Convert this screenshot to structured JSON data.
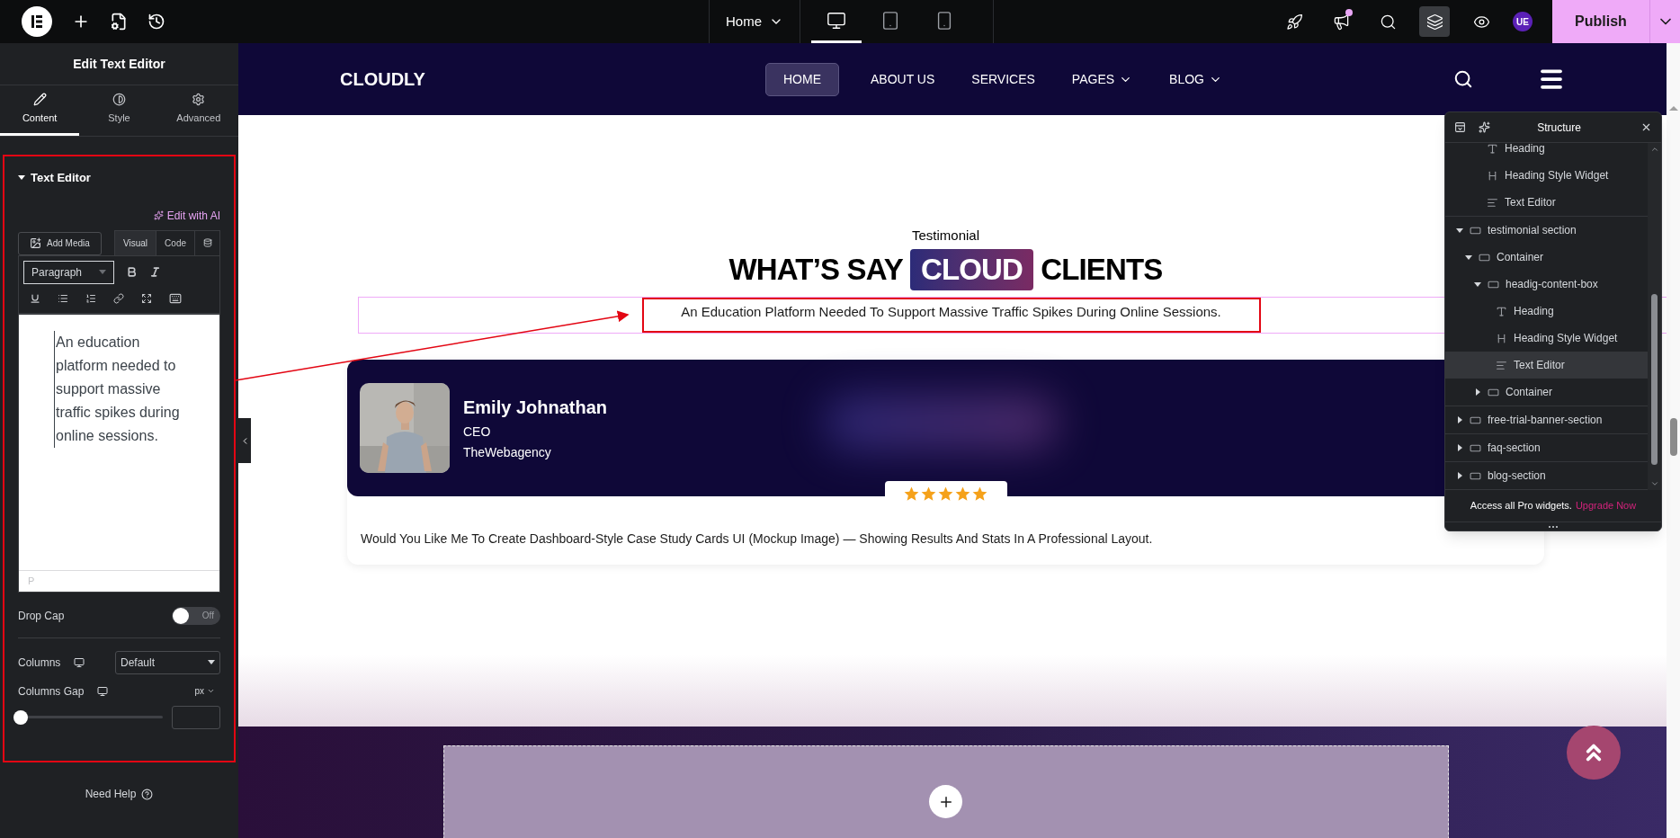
{
  "topbar": {
    "page": "Home",
    "devices": [
      {
        "kind": "desktop",
        "selected": true
      },
      {
        "kind": "tablet",
        "selected": false
      },
      {
        "kind": "mobile",
        "selected": false
      }
    ],
    "tools": [
      {
        "kind": "rocket",
        "selected": false,
        "badge": false
      },
      {
        "kind": "megaphone",
        "selected": false,
        "badge": true
      },
      {
        "kind": "search",
        "selected": false,
        "badge": false
      },
      {
        "kind": "layers",
        "selected": true,
        "badge": false
      },
      {
        "kind": "preview",
        "selected": false,
        "badge": false
      }
    ],
    "avatar": "UE",
    "publish": "Publish"
  },
  "panel": {
    "title": "Edit Text Editor",
    "tabs": [
      {
        "kind": "content",
        "label": "Content",
        "selected": true
      },
      {
        "kind": "style",
        "label": "Style",
        "selected": false
      },
      {
        "kind": "advanced",
        "label": "Advanced",
        "selected": false
      }
    ],
    "section": {
      "title": "Text Editor",
      "expanded": true
    },
    "ai_link": "Edit with AI",
    "add_media": "Add Media",
    "editor_tabs": [
      {
        "label": "Visual",
        "selected": true
      },
      {
        "label": "Code",
        "selected": false
      }
    ],
    "format": "Paragraph",
    "content": "An education platform needed to support massive traffic spikes during online sessions.",
    "element_path": "P",
    "drop_cap": {
      "label": "Drop Cap",
      "on": false,
      "state": "Off"
    },
    "columns": {
      "label": "Columns",
      "value": "Default"
    },
    "columns_gap": {
      "label": "Columns Gap",
      "unit": "px",
      "level": 0
    },
    "help": "Need Help"
  },
  "site": {
    "logo": "CLOUDLY",
    "nav": [
      {
        "label": "HOME",
        "selected": true,
        "dropdown": false
      },
      {
        "label": "ABOUT US",
        "selected": false,
        "dropdown": false
      },
      {
        "label": "SERVICES",
        "selected": false,
        "dropdown": false
      },
      {
        "label": "PAGES",
        "selected": false,
        "dropdown": true
      },
      {
        "label": "BLOG",
        "selected": false,
        "dropdown": true
      }
    ],
    "eyebrow": "Testimonial",
    "heading": [
      {
        "text": "WHAT’S SAY",
        "highlight": false
      },
      {
        "text": "CLOUD",
        "highlight": true
      },
      {
        "text": "CLIENTS",
        "highlight": false
      }
    ],
    "subtitle": "An Education Platform Needed To Support Massive Traffic Spikes During Online Sessions.",
    "card": {
      "name": "Emily Johnathan",
      "role": "CEO",
      "company": "TheWebagency",
      "stars": 5,
      "quote": "Would You Like Me To Create Dashboard-Style Case Study Cards UI (Mockup Image) — Showing Results And Stats In A Professional Layout."
    }
  },
  "structure": {
    "title": "Structure",
    "tree": [
      {
        "children": [
          {
            "children": [
              {
                "label": "Heading",
                "kind": "heading",
                "selected": false
              },
              {
                "label": "Heading Style Widget",
                "kind": "heading-style",
                "selected": false
              },
              {
                "label": "Text Editor",
                "kind": "text",
                "selected": false
              }
            ]
          }
        ]
      },
      {
        "label": "testimonial section",
        "kind": "container",
        "selected": false,
        "expanded": true,
        "children": [
          {
            "label": "Container",
            "kind": "container",
            "selected": false,
            "expanded": true,
            "children": [
              {
                "label": "headig-content-box",
                "kind": "container",
                "selected": false,
                "expanded": true,
                "children": [
                  {
                    "label": "Heading",
                    "kind": "heading",
                    "selected": false
                  },
                  {
                    "label": "Heading Style Widget",
                    "kind": "heading-style",
                    "selected": false
                  },
                  {
                    "label": "Text Editor",
                    "kind": "text",
                    "selected": true
                  }
                ]
              },
              {
                "label": "Container",
                "kind": "container",
                "selected": false,
                "expanded": false
              }
            ]
          }
        ]
      },
      {
        "label": "free-trial-banner-section",
        "kind": "container",
        "selected": false,
        "expanded": false
      },
      {
        "label": "faq-section",
        "kind": "container",
        "selected": false,
        "expanded": false
      },
      {
        "label": "blog-section",
        "kind": "container",
        "selected": false,
        "expanded": false
      }
    ],
    "footer_text": "Access all Pro widgets.",
    "footer_link": "Upgrade Now"
  }
}
